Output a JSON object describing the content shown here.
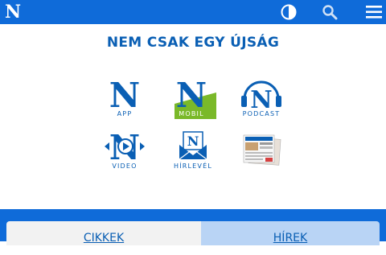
{
  "header": {
    "logo": "N",
    "icons": [
      "contrast-icon",
      "search-icon",
      "menu-icon"
    ],
    "bar_color": "#0f6bd9"
  },
  "headline": "NEM CSAK EGY ÚJSÁG",
  "products": [
    {
      "label": "APP",
      "icon": "app-logo-icon"
    },
    {
      "label": "MOBIL",
      "icon": "mobile-logo-icon"
    },
    {
      "label": "PODCAST",
      "icon": "podcast-logo-icon"
    },
    {
      "label": "VIDEO",
      "icon": "video-logo-icon"
    },
    {
      "label": "HÍRLEVÉL",
      "icon": "newsletter-envelope-icon"
    },
    {
      "label": "",
      "icon": "newspaper-print-icon"
    }
  ],
  "tabs": {
    "left": "CIKKEK",
    "right": "HÍREK"
  },
  "colors": {
    "brand_blue": "#0a5fb4",
    "mobil_green": "#7ab929"
  }
}
